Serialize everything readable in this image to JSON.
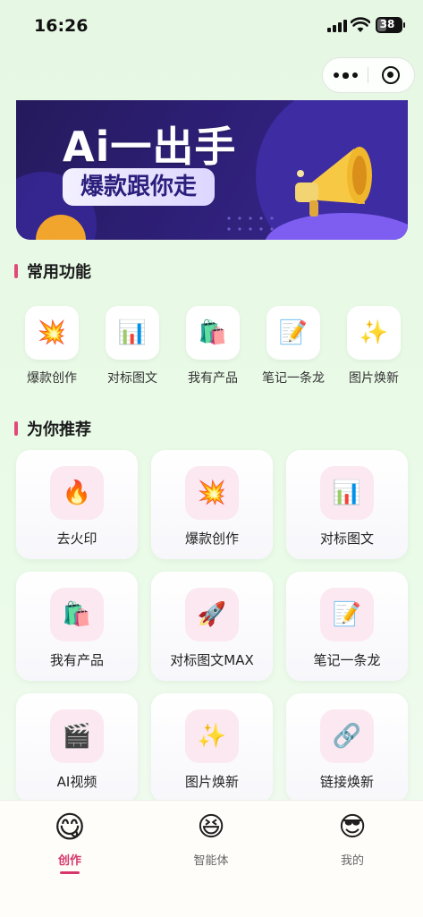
{
  "status": {
    "time": "16:26",
    "battery": "38"
  },
  "capsule": {
    "more_icon": "more-dots-icon",
    "close_icon": "target-circle-icon"
  },
  "banner": {
    "title": "Ai一出手",
    "subtitle": "爆款跟你走",
    "illustration": "megaphone-icon",
    "accent": "#2e1f78"
  },
  "sections": {
    "common": "常用功能",
    "recommend": "为你推荐"
  },
  "common_features": [
    {
      "label": "爆款创作",
      "icon": "💥"
    },
    {
      "label": "对标图文",
      "icon": "📊"
    },
    {
      "label": "我有产品",
      "icon": "🛍️"
    },
    {
      "label": "笔记一条龙",
      "icon": "📝"
    },
    {
      "label": "图片焕新",
      "icon": "✨"
    }
  ],
  "recommendations": [
    {
      "label": "去火印",
      "icon": "🔥"
    },
    {
      "label": "爆款创作",
      "icon": "💥"
    },
    {
      "label": "对标图文",
      "icon": "📊"
    },
    {
      "label": "我有产品",
      "icon": "🛍️"
    },
    {
      "label": "对标图文MAX",
      "icon": "🚀"
    },
    {
      "label": "笔记一条龙",
      "icon": "📝"
    },
    {
      "label": "AI视频",
      "icon": "🎬"
    },
    {
      "label": "图片焕新",
      "icon": "✨"
    },
    {
      "label": "链接焕新",
      "icon": "🔗"
    }
  ],
  "tabs": [
    {
      "label": "创作",
      "icon": "😋",
      "active": true
    },
    {
      "label": "智能体",
      "icon": "😆",
      "active": false
    },
    {
      "label": "我的",
      "icon": "😎",
      "active": false
    }
  ],
  "colors": {
    "accent": "#d6366a",
    "section_bar": "#e04a78",
    "background": "#e6f8e4"
  }
}
